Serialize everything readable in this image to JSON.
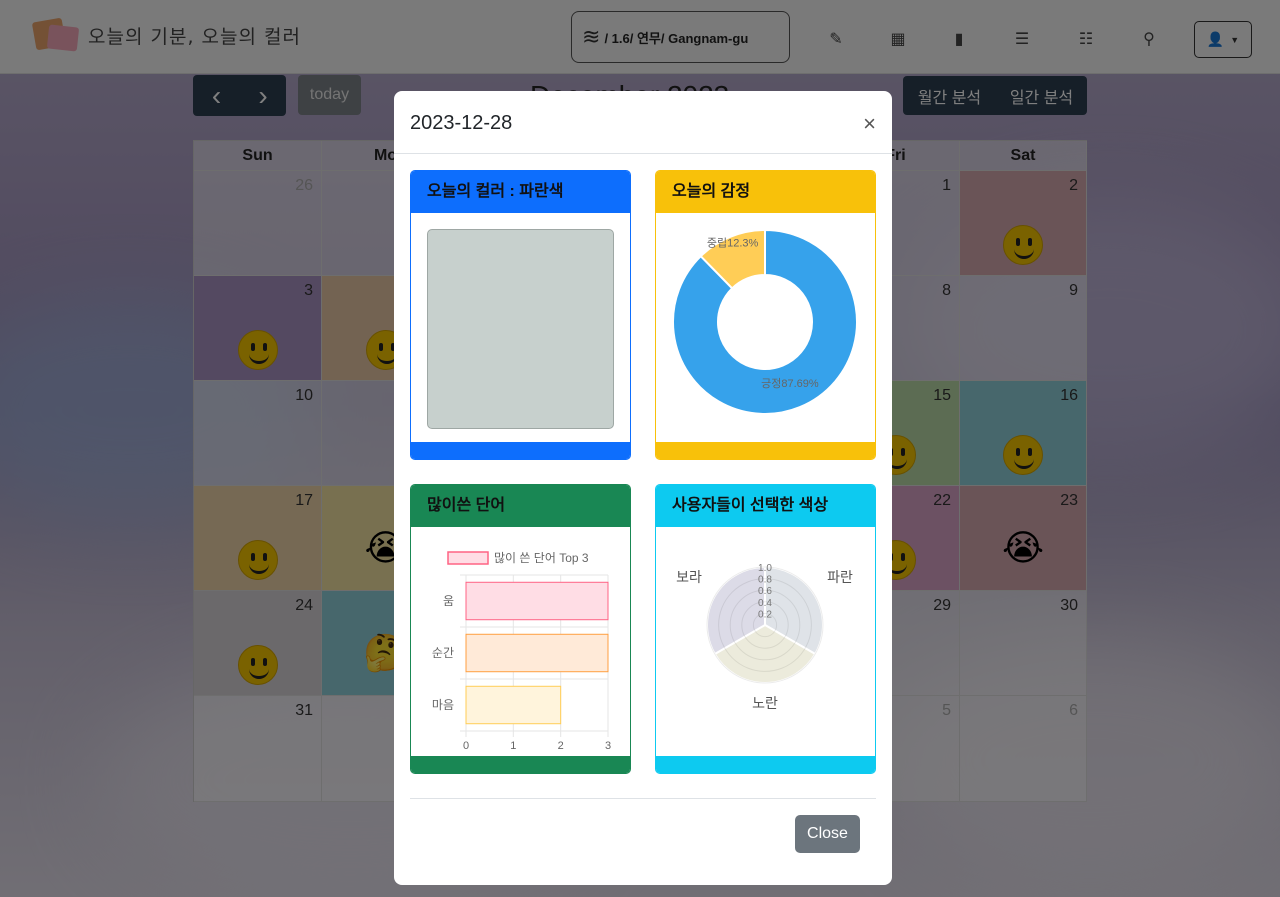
{
  "navbar": {
    "brand_title": "오늘의 기분, 오늘의 컬러",
    "weather_text": "/ 1.6/ 연무/ Gangnam-gu",
    "icons": [
      "pencil-square-icon",
      "calendar-icon",
      "book-icon",
      "list-alt-icon",
      "list-icon",
      "map-marker-icon",
      "user-icon"
    ]
  },
  "calendar": {
    "prev_label": "‹",
    "next_label": "›",
    "today_label": "today",
    "title": "December 2023",
    "monthly_analysis": "월간 분석",
    "daily_analysis": "일간 분석",
    "day_headers": [
      "Sun",
      "Mo",
      "",
      "",
      "",
      "Fri",
      "Sat"
    ],
    "visible_days": [
      {
        "label": "26",
        "dim": true
      },
      {
        "label": "1"
      },
      {
        "label": "2"
      },
      {
        "label": "3"
      },
      {
        "label": "8"
      },
      {
        "label": "9"
      },
      {
        "label": "10"
      },
      {
        "label": "15"
      },
      {
        "label": "16"
      },
      {
        "label": "17"
      },
      {
        "label": "22"
      },
      {
        "label": "23"
      },
      {
        "label": "24"
      },
      {
        "label": "29"
      },
      {
        "label": "30"
      },
      {
        "label": "31"
      },
      {
        "label": "5",
        "dim": true
      },
      {
        "label": "6",
        "dim": true
      }
    ]
  },
  "modal": {
    "title": "2023-12-28",
    "close_icon": "×",
    "close_label": "Close",
    "color_card": {
      "header": "오늘의 컬러 : 파란색",
      "accent": "#0d6efd",
      "swatch_color": "#c7d0cd"
    },
    "emotion_card": {
      "header": "오늘의 감정",
      "accent": "#f8c10a"
    },
    "words_card": {
      "header": "많이쓴 단어",
      "accent": "#198754"
    },
    "colors_card": {
      "header": "사용자들이 선택한 색상",
      "accent": "#0dcaf0"
    }
  },
  "chart_data": [
    {
      "type": "pie",
      "variant": "doughnut",
      "labels": [
        "긍정",
        "중립"
      ],
      "values": [
        87.69,
        12.3
      ],
      "data_labels": [
        "긍정87.69%",
        "중립12.3%"
      ],
      "colors": [
        "#36a2eb",
        "#ffcd56"
      ]
    },
    {
      "type": "bar",
      "orientation": "horizontal",
      "categories": [
        "움",
        "순간",
        "마음"
      ],
      "series": [
        {
          "name": "많이 쓴 단어 Top 3",
          "values": [
            3,
            3,
            2
          ]
        }
      ],
      "xlim": [
        0,
        3
      ],
      "x_ticks": [
        "0",
        "1",
        "2",
        "3"
      ],
      "colors": [
        "#ffdde5",
        "#ffead8",
        "#fff4dc"
      ],
      "border_colors": [
        "#ff6384",
        "#ff9f40",
        "#ffcd56"
      ],
      "legend": "top",
      "grid": true
    },
    {
      "type": "pie",
      "variant": "polar-area",
      "labels": [
        "파란",
        "노란",
        "보라"
      ],
      "values": [
        1.0,
        1.0,
        1.0
      ],
      "r_ticks": [
        "0.2",
        "0.4",
        "0.6",
        "0.8",
        "1.0"
      ],
      "colors": [
        "#dfe3e8",
        "#ecebdc",
        "#dcdbe7"
      ]
    }
  ]
}
